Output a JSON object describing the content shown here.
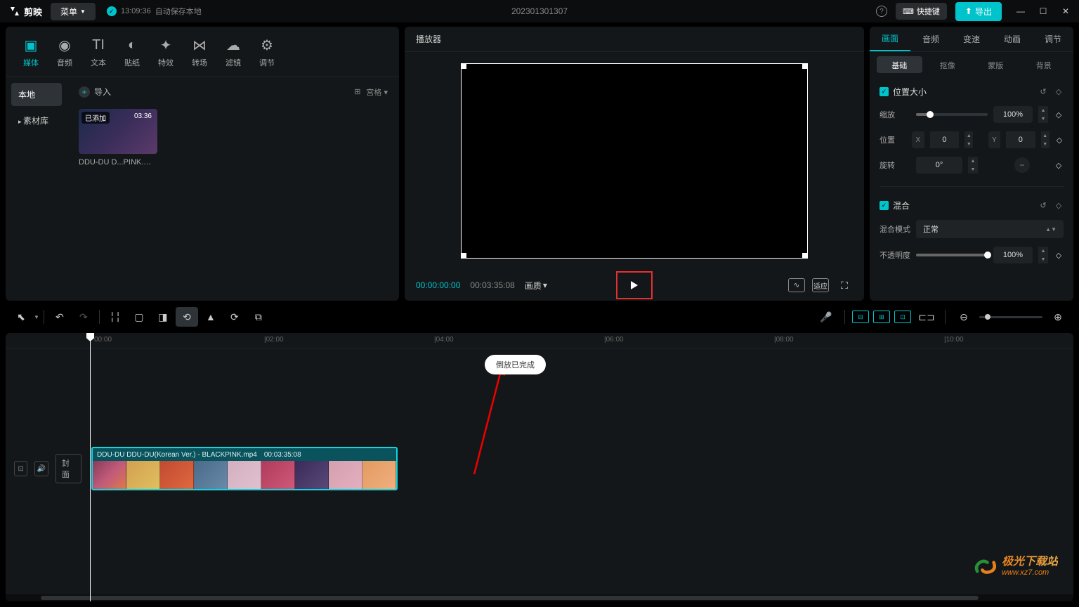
{
  "titlebar": {
    "app_name": "剪映",
    "menu": "菜单",
    "autosave_time": "13:09:36",
    "autosave_text": "自动保存本地",
    "project_name": "202301301307",
    "shortcut": "快捷键",
    "export": "导出"
  },
  "media_tabs": [
    {
      "icon": "▣",
      "label": "媒体"
    },
    {
      "icon": "◉",
      "label": "音频"
    },
    {
      "icon": "TI",
      "label": "文本"
    },
    {
      "icon": "◐",
      "label": "贴纸"
    },
    {
      "icon": "✦",
      "label": "特效"
    },
    {
      "icon": "⋈",
      "label": "转场"
    },
    {
      "icon": "☁",
      "label": "滤镜"
    },
    {
      "icon": "⚙",
      "label": "调节"
    }
  ],
  "media_side": {
    "local": "本地",
    "library": "素材库"
  },
  "import": {
    "label": "导入",
    "view": "宫格"
  },
  "clip": {
    "badge": "已添加",
    "duration": "03:36",
    "name": "DDU-DU D...PINK.mp4"
  },
  "player": {
    "title": "播放器",
    "time_current": "00:00:00:00",
    "time_total": "00:03:35:08",
    "quality": "画质",
    "ratio": "适应"
  },
  "props": {
    "tabs": [
      "画面",
      "音频",
      "变速",
      "动画",
      "调节"
    ],
    "subtabs": [
      "基础",
      "抠像",
      "蒙版",
      "背景"
    ],
    "pos_size": "位置大小",
    "scale": "缩放",
    "scale_val": "100%",
    "position": "位置",
    "x": "X",
    "x_val": "0",
    "y": "Y",
    "y_val": "0",
    "rotate": "旋转",
    "rotate_val": "0°",
    "blend": "混合",
    "blend_mode": "混合模式",
    "blend_normal": "正常",
    "opacity": "不透明度",
    "opacity_val": "100%"
  },
  "timeline": {
    "ruler": [
      "00:00",
      "|02:00",
      "|04:00",
      "|06:00",
      "|08:00",
      "|10:00"
    ],
    "cover": "封面",
    "clip_name": "DDU-DU DDU-DU(Korean Ver.) - BLACKPINK.mp4",
    "clip_dur": "00:03:35:08"
  },
  "toast": "倒放已完成",
  "watermark": {
    "cn": "极光下载站",
    "url": "www.xz7.com"
  }
}
